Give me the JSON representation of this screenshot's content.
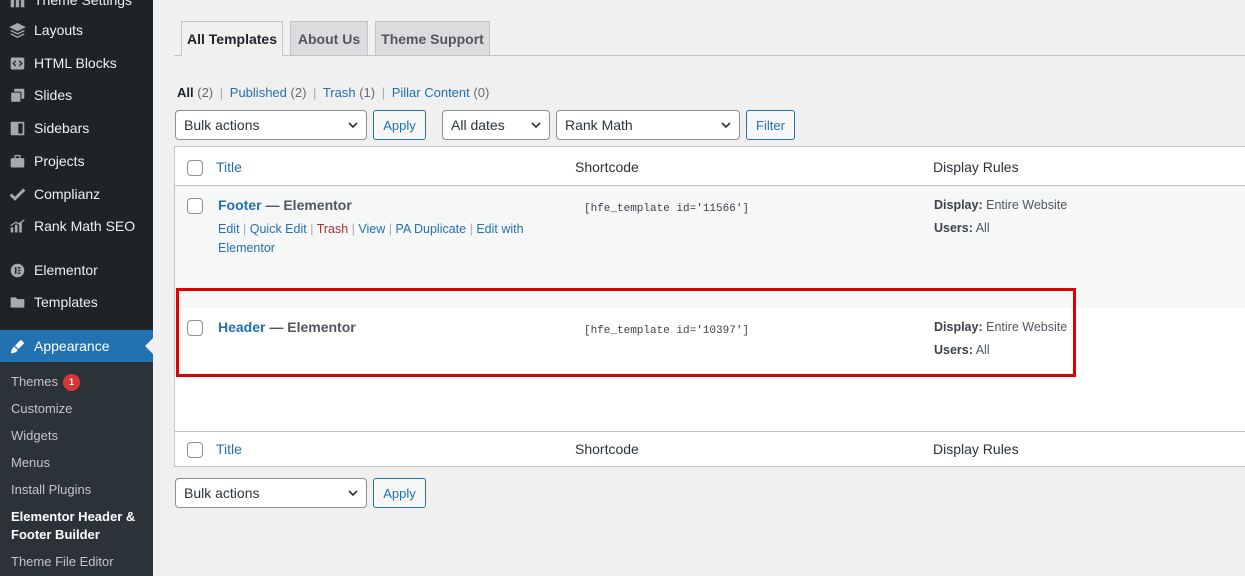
{
  "sidebar": {
    "items": [
      {
        "label": "Theme Settings",
        "icon": "grid-icon"
      },
      {
        "label": "Layouts",
        "icon": "layers-icon"
      },
      {
        "label": "HTML Blocks",
        "icon": "code-block-icon"
      },
      {
        "label": "Slides",
        "icon": "slides-icon"
      },
      {
        "label": "Sidebars",
        "icon": "sidebar-icon"
      },
      {
        "label": "Projects",
        "icon": "briefcase-icon"
      },
      {
        "label": "Complianz",
        "icon": "check-icon"
      },
      {
        "label": "Rank Math SEO",
        "icon": "chart-icon"
      },
      {
        "label": "Elementor",
        "icon": "elementor-icon"
      },
      {
        "label": "Templates",
        "icon": "folder-icon"
      },
      {
        "label": "Appearance",
        "icon": "brush-icon"
      }
    ],
    "submenu": [
      {
        "label": "Themes",
        "badge": "1"
      },
      {
        "label": "Customize"
      },
      {
        "label": "Widgets"
      },
      {
        "label": "Menus"
      },
      {
        "label": "Install Plugins"
      },
      {
        "label": "Elementor Header & Footer Builder"
      },
      {
        "label": "Theme File Editor"
      }
    ]
  },
  "tabs": [
    "All Templates",
    "About Us",
    "Theme Support"
  ],
  "filters": {
    "all_label": "All",
    "all_count": "(2)",
    "published_label": "Published",
    "published_count": "(2)",
    "trash_label": "Trash",
    "trash_count": "(1)",
    "pillar_label": "Pillar Content",
    "pillar_count": "(0)",
    "separator": "|"
  },
  "controls": {
    "bulk_actions": "Bulk actions",
    "apply": "Apply",
    "all_dates": "All dates",
    "rank_math": "Rank Math",
    "filter": "Filter"
  },
  "table": {
    "columns": [
      "Title",
      "Shortcode",
      "Display Rules"
    ],
    "rows": [
      {
        "name": "Footer",
        "state": " — Elementor",
        "shortcode": "[hfe_template id='11566']",
        "display_label": "Display:",
        "display_value": "Entire Website",
        "users_label": "Users:",
        "users_value": "All",
        "actions": [
          "Edit",
          "Quick Edit",
          "Trash",
          "View",
          "PA Duplicate",
          "Edit with Elementor"
        ]
      },
      {
        "name": "Header",
        "state": " — Elementor",
        "shortcode": "[hfe_template id='10397']",
        "display_label": "Display:",
        "display_value": "Entire Website",
        "users_label": "Users:",
        "users_value": "All"
      }
    ]
  },
  "colors": {
    "sidebar_bg": "#1d2327",
    "active_blue": "#2271b1",
    "highlight_red": "#e00000",
    "badge_red": "#d63638"
  }
}
